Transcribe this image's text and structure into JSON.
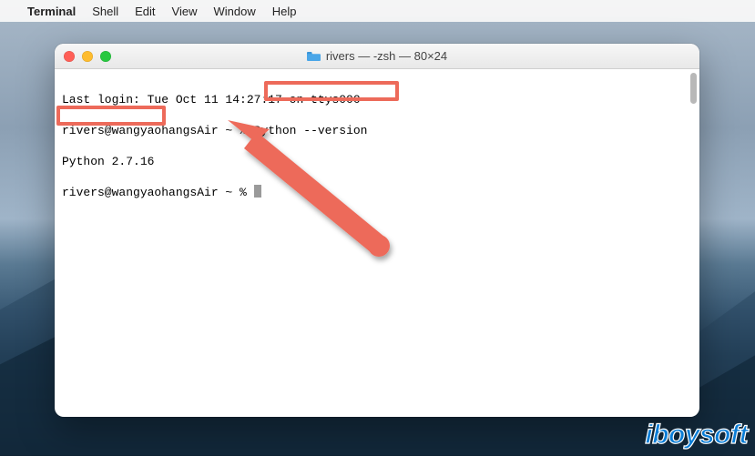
{
  "menubar": {
    "app": "Terminal",
    "items": [
      "Shell",
      "Edit",
      "View",
      "Window",
      "Help"
    ]
  },
  "window": {
    "title": "rivers — -zsh — 80×24",
    "folder_icon": "folder-icon"
  },
  "terminal": {
    "last_login_prefix": "Last login: Tue Oct 11 14:",
    "last_login_suffix_obscured": "27:17 on ttys000",
    "prompt": "rivers@wangyaohangsAir ~ %",
    "command": "Python --version",
    "output": "Python 2.7.16",
    "prompt2": "rivers@wangyaohangsAir ~ %"
  },
  "annotations": {
    "highlight_command": true,
    "highlight_output": true,
    "arrow_color": "#ed6a5a"
  },
  "watermark": "iBoysoft"
}
